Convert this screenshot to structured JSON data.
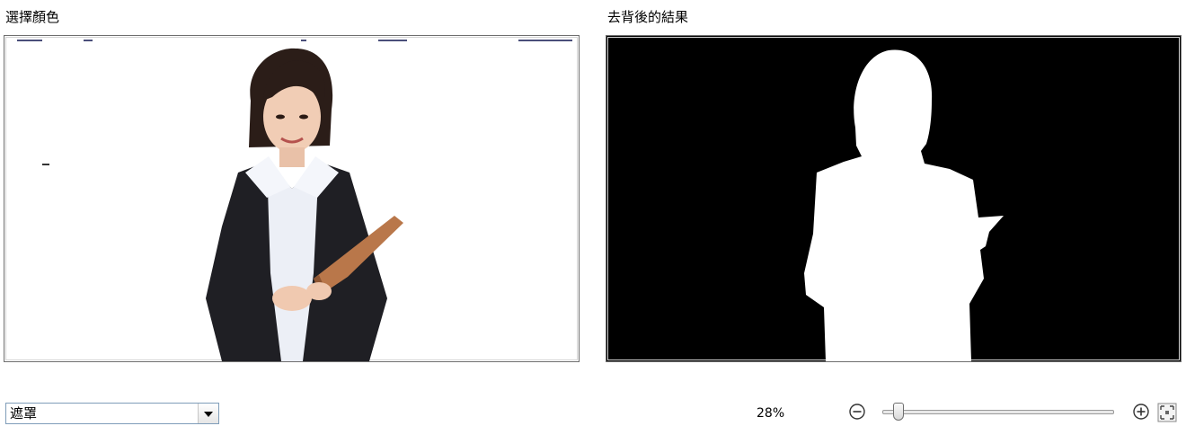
{
  "left_panel": {
    "title": "選擇顏色"
  },
  "right_panel": {
    "title": "去背後的結果"
  },
  "mode_select": {
    "selected": "遮罩",
    "icon": "chevron-down-icon"
  },
  "zoom": {
    "label": "28%",
    "level_fraction": 0.05,
    "zoom_out_icon": "minus-circle-icon",
    "zoom_in_icon": "plus-circle-icon",
    "fit_icon": "fit-to-window-icon"
  },
  "colors": {
    "panel_border": "#6e6e6e",
    "mask_background": "#000000",
    "mask_foreground": "#ffffff"
  }
}
